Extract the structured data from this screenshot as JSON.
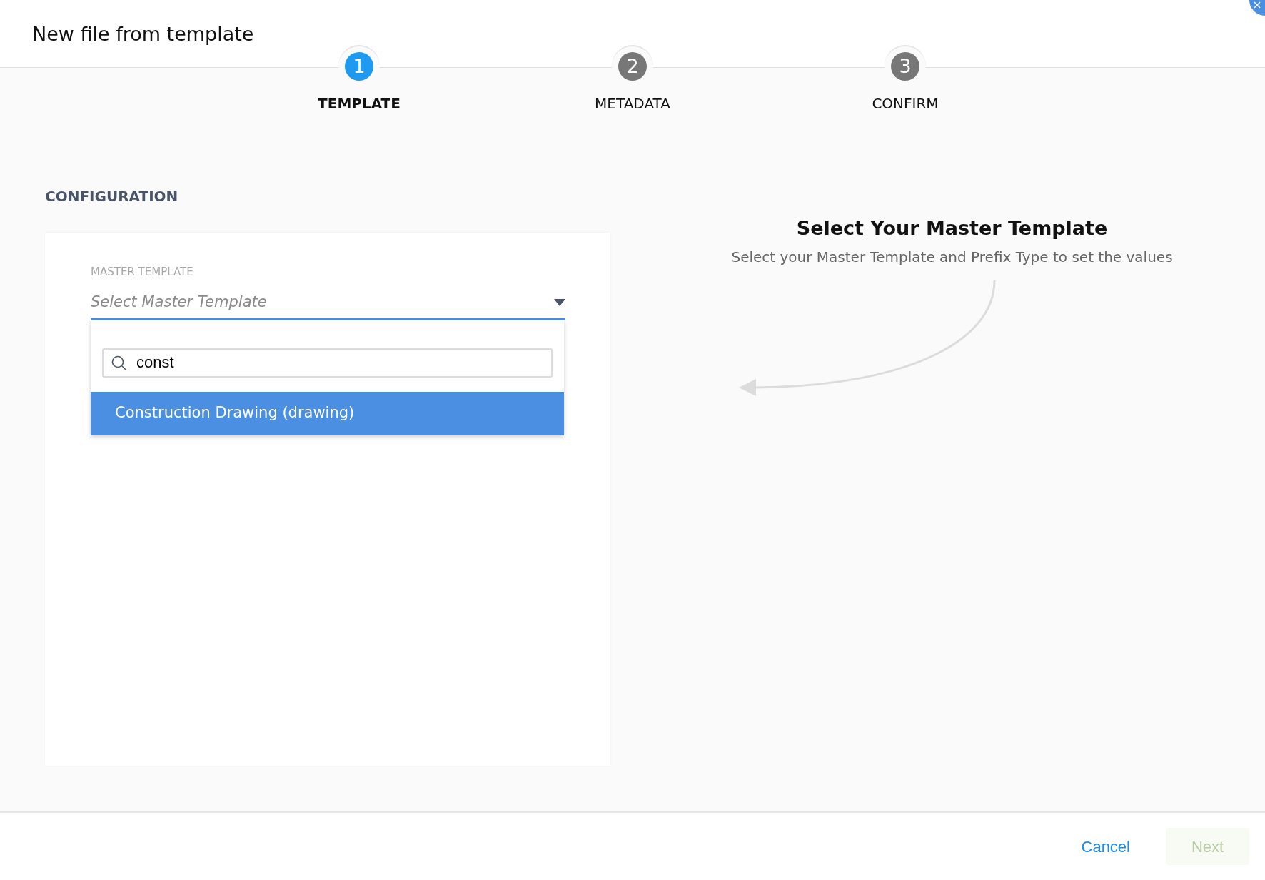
{
  "window": {
    "title": "New file from template"
  },
  "steps": [
    {
      "number": "1",
      "label": "TEMPLATE",
      "selected": true
    },
    {
      "number": "2",
      "label": "METADATA",
      "selected": false
    },
    {
      "number": "3",
      "label": "CONFIRM",
      "selected": false
    }
  ],
  "section": {
    "title": "CONFIGURATION"
  },
  "master_template": {
    "label": "MASTER TEMPLATE",
    "placeholder": "Select Master Template",
    "expanded": true,
    "search": {
      "value": "const"
    },
    "options": [
      {
        "label": "Construction Drawing (drawing)",
        "selected": true
      }
    ]
  },
  "hint": {
    "title": "Select Your Master Template",
    "text": "Select your Master Template and Prefix Type to set the values"
  },
  "buttons": [
    {
      "label": "Cancel",
      "kind": "link",
      "disabled": false
    },
    {
      "label": "Next",
      "kind": "primary",
      "disabled": true
    }
  ]
}
